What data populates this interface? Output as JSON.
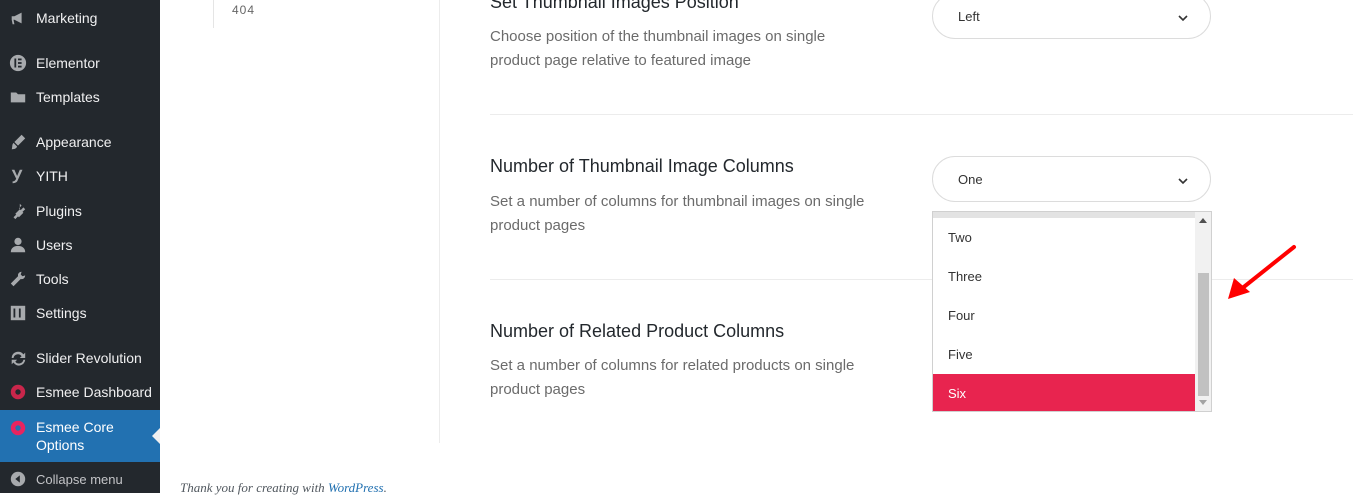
{
  "sidebar": {
    "items": [
      {
        "label": "Marketing",
        "icon": "megaphone-icon"
      },
      {
        "label": "Elementor",
        "icon": "elementor-icon"
      },
      {
        "label": "Templates",
        "icon": "folder-icon"
      },
      {
        "label": "Appearance",
        "icon": "paintbrush-icon"
      },
      {
        "label": "YITH",
        "icon": "yith-icon"
      },
      {
        "label": "Plugins",
        "icon": "plugin-icon"
      },
      {
        "label": "Users",
        "icon": "user-icon"
      },
      {
        "label": "Tools",
        "icon": "wrench-icon"
      },
      {
        "label": "Settings",
        "icon": "sliders-icon"
      },
      {
        "label": "Slider Revolution",
        "icon": "refresh-icon"
      },
      {
        "label": "Esmee Dashboard",
        "icon": "esmee-icon"
      },
      {
        "label": "Esmee Core Options",
        "icon": "esmee-icon",
        "active": true
      },
      {
        "label": "Collapse menu",
        "icon": "collapse-icon"
      }
    ]
  },
  "left_panel": {
    "item_404": "404"
  },
  "sections": {
    "thumb_position": {
      "title": "Set Thumbnail Images Position",
      "description": "Choose position of the thumbnail images on single product page relative to featured image",
      "value": "Left"
    },
    "thumb_columns": {
      "title": "Number of Thumbnail Image Columns",
      "description": "Set a number of columns for thumbnail images on single product pages",
      "value": "One",
      "options": [
        "Two",
        "Three",
        "Four",
        "Five",
        "Six"
      ],
      "highlighted": "Six"
    },
    "related_columns": {
      "title": "Number of Related Product Columns",
      "description": "Set a number of columns for related products on single product pages"
    }
  },
  "footer": {
    "text": "Thank you for creating with ",
    "link": "WordPress",
    "end": "."
  },
  "colors": {
    "sidebar_bg": "#23282d",
    "active_bg": "#2271b1",
    "highlight": "#e8244f",
    "arrow": "#ff0000"
  }
}
